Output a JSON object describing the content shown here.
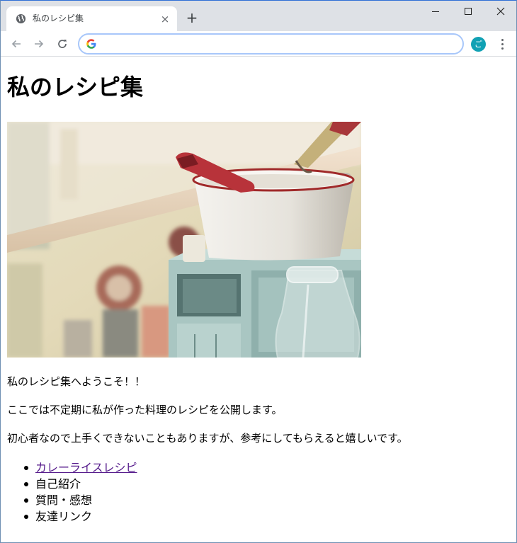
{
  "browser": {
    "tab_title": "私のレシピ集",
    "tab_close_label": "×",
    "new_tab_label": "+",
    "omnibox_value": "",
    "profile_initial": "ご",
    "colors": {
      "tabstrip": "#dee1e6",
      "omnibox_border": "#a8c7fa",
      "avatar": "#11a1b4"
    },
    "icons": {
      "favicon": "globe-icon",
      "back": "arrow-left-icon",
      "forward": "arrow-right-icon",
      "reload": "reload-icon",
      "search_engine": "google-g-icon",
      "menu": "vertical-dots-icon",
      "minimize": "minimize-icon",
      "maximize": "maximize-icon",
      "close": "close-icon"
    }
  },
  "page": {
    "title": "私のレシピ集",
    "hero_image": "kitchen-pots-photo",
    "paragraphs": [
      "私のレシピ集へようこそ！！",
      "ここでは不定期に私が作った料理のレシピを公開します。",
      "初心者なので上手くできないこともありますが、参考にしてもらえると嬉しいです。"
    ],
    "menu": [
      {
        "label": "カレーライスレシピ",
        "is_link": true
      },
      {
        "label": "自己紹介",
        "is_link": false
      },
      {
        "label": "質問・感想",
        "is_link": false
      },
      {
        "label": "友達リンク",
        "is_link": false
      }
    ],
    "link_color": "#551a8b"
  }
}
